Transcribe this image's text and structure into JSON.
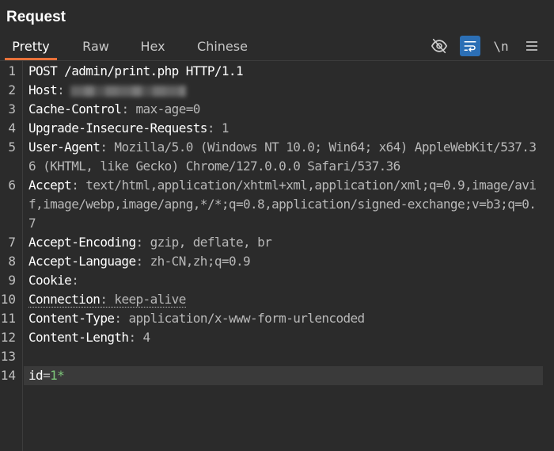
{
  "panel": {
    "title": "Request"
  },
  "tabs": [
    {
      "label": "Pretty",
      "active": true
    },
    {
      "label": "Raw",
      "active": false
    },
    {
      "label": "Hex",
      "active": false
    },
    {
      "label": "Chinese",
      "active": false
    }
  ],
  "toolbar": {
    "newline_label": "\\n",
    "icons": [
      "eye-off-icon",
      "wrap-lines-icon",
      "newline-icon",
      "menu-icon"
    ],
    "accent": "#2c6fb5"
  },
  "tab_accent": "#e8713a",
  "editor": {
    "lines": [
      {
        "num": "1",
        "text": "POST /admin/print.php HTTP/1.1"
      },
      {
        "num": "2",
        "name": "Host",
        "sep": ":",
        "value": ""
      },
      {
        "num": "3",
        "name": "Cache-Control",
        "sep": ":",
        "value": " max-age=0"
      },
      {
        "num": "4",
        "name": "Upgrade-Insecure-Requests",
        "sep": ":",
        "value": " 1"
      },
      {
        "num": "5",
        "name": "User-Agent",
        "sep": ":",
        "value": " Mozilla/5.0 (Windows NT 10.0; Win64; x64) AppleWebKit/537.36 (KHTML, like Gecko) Chrome/127.0.0.0 Safari/537.36"
      },
      {
        "num": "6",
        "name": "Accept",
        "sep": ":",
        "value": " text/html,application/xhtml+xml,application/xml;q=0.9,image/avif,image/webp,image/apng,*/*;q=0.8,application/signed-exchange;v=b3;q=0.7"
      },
      {
        "num": "7",
        "name": "Accept-Encoding",
        "sep": ":",
        "value": " gzip, deflate, br"
      },
      {
        "num": "8",
        "name": "Accept-Language",
        "sep": ":",
        "value": " zh-CN,zh;q=0.9"
      },
      {
        "num": "9",
        "name": "Cookie",
        "sep": ":",
        "value": ""
      },
      {
        "num": "10",
        "name": "Connection",
        "sep": ":",
        "value": " keep-alive"
      },
      {
        "num": "11",
        "name": "Content-Type",
        "sep": ":",
        "value": " application/x-www-form-urlencoded"
      },
      {
        "num": "12",
        "name": "Content-Length",
        "sep": ":",
        "value": " 4"
      },
      {
        "num": "13",
        "text": ""
      },
      {
        "num": "14",
        "key": "id",
        "eq": "=",
        "val": "1*"
      }
    ]
  }
}
